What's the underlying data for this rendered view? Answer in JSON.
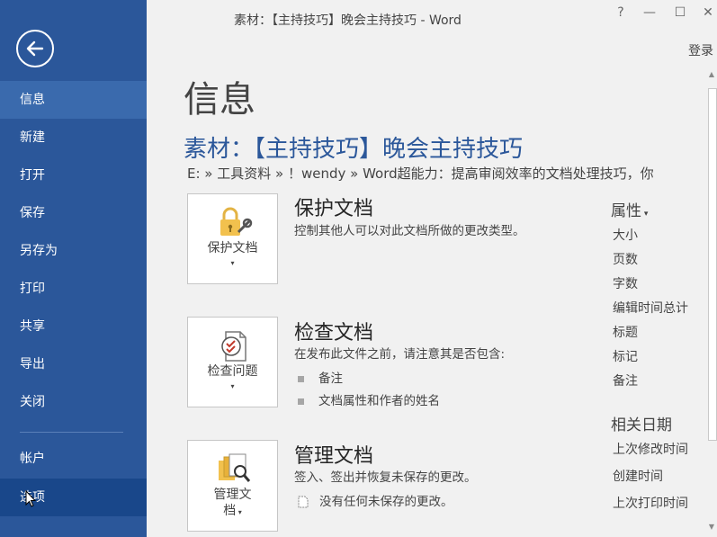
{
  "window": {
    "title": "素材：【主持技巧】晚会主持技巧 - Word",
    "help": "?",
    "minimize": "—",
    "maximize": "☐",
    "close": "✕",
    "login": "登录"
  },
  "sidebar": {
    "items": [
      {
        "label": "信息"
      },
      {
        "label": "新建"
      },
      {
        "label": "打开"
      },
      {
        "label": "保存"
      },
      {
        "label": "另存为"
      },
      {
        "label": "打印"
      },
      {
        "label": "共享"
      },
      {
        "label": "导出"
      },
      {
        "label": "关闭"
      },
      {
        "label": "帐户"
      },
      {
        "label": "选项"
      }
    ]
  },
  "main": {
    "page_title": "信息",
    "doc_title": "素材：【主持技巧】晚会主持技巧",
    "path": "E: » 工具资料 » ！wendy » Word超能力：提高审阅效率的文档处理技巧，你"
  },
  "protect": {
    "button_label": "保护文档",
    "title": "保护文档",
    "desc": "控制其他人可以对此文档所做的更改类型。"
  },
  "inspect": {
    "button_label": "检查问题",
    "title": "检查文档",
    "desc": "在发布此文件之前，请注意其是否包含:",
    "bullets": [
      "备注",
      "文档属性和作者的姓名"
    ]
  },
  "manage": {
    "button_label_1": "管理文",
    "button_label_2": "档",
    "title": "管理文档",
    "desc": "签入、签出并恢复未保存的更改。",
    "note": "没有任何未保存的更改。"
  },
  "properties": {
    "title": "属性",
    "items": [
      "大小",
      "页数",
      "字数",
      "编辑时间总计",
      "标题",
      "标记",
      "备注"
    ]
  },
  "dates": {
    "title": "相关日期",
    "items": [
      "上次修改时间",
      "创建时间",
      "上次打印时间"
    ]
  },
  "colors": {
    "sidebar": "#2b579a",
    "accent": "#2b579a"
  }
}
